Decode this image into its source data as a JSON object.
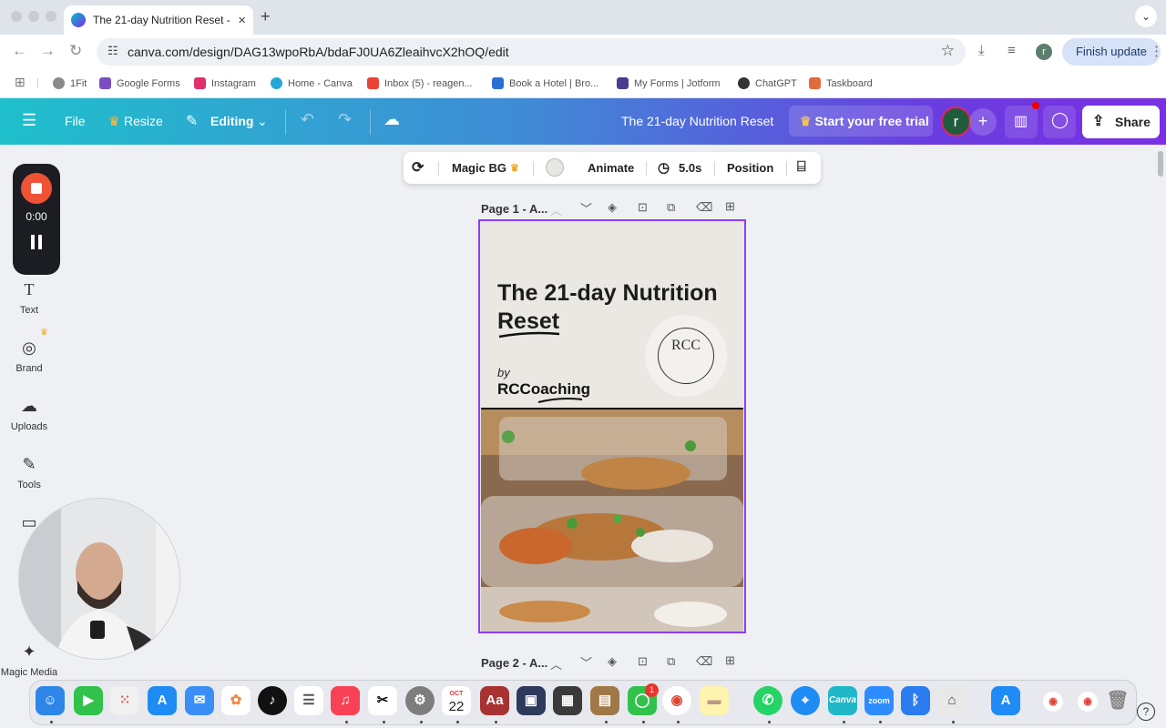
{
  "browser": {
    "tab_title": "The 21-day Nutrition Reset -",
    "new_tab": "+",
    "url": "canva.com/design/DAG13wpoRbA/bdaFJ0UA6ZleaihvcX2hOQ/edit",
    "profile_initial": "r",
    "finish_update": "Finish update",
    "bookmarks": [
      {
        "label": "1Fit",
        "color": "#8a8a8a"
      },
      {
        "label": "Google Forms",
        "color": "#7b4fc4"
      },
      {
        "label": "Instagram",
        "color": "#e1306c"
      },
      {
        "label": "Home - Canva",
        "color": "#23a8d6"
      },
      {
        "label": "Inbox (5) - reagen...",
        "color": "#ea4335"
      },
      {
        "label": "Book a Hotel | Bro...",
        "color": "#2b6fd6"
      },
      {
        "label": "My Forms | Jotform",
        "color": "#4a3c8e"
      },
      {
        "label": "ChatGPT",
        "color": "#333333"
      },
      {
        "label": "Taskboard",
        "color": "#e26b3c"
      }
    ]
  },
  "canva": {
    "file": "File",
    "resize": "Resize",
    "editing": "Editing",
    "doc_title": "The 21-day Nutrition Reset",
    "trial": "Start your free trial",
    "avatar_initial": "r",
    "share": "Share",
    "accent": "#8b3dff"
  },
  "rail": [
    {
      "label": "Text",
      "icon": "T"
    },
    {
      "label": "Brand",
      "icon": "◎"
    },
    {
      "label": "Uploads",
      "icon": "☁"
    },
    {
      "label": "Tools",
      "icon": "✎"
    },
    {
      "label": "Magic Media",
      "icon": "✦"
    }
  ],
  "recorder": {
    "time": "0:00"
  },
  "context_toolbar": {
    "magic_bg": "Magic BG",
    "animate": "Animate",
    "duration": "5.0s",
    "position": "Position"
  },
  "pages": [
    {
      "label": "Page 1 - A..."
    },
    {
      "label": "Page 2 - A..."
    }
  ],
  "design": {
    "title": "The 21-day Nutrition Reset",
    "by": "by",
    "brand": "RCCoaching",
    "seal": "RCC"
  },
  "dock": {
    "calendar_month": "OCT",
    "calendar_day": "22",
    "messages_badge": "1",
    "help": "?"
  }
}
